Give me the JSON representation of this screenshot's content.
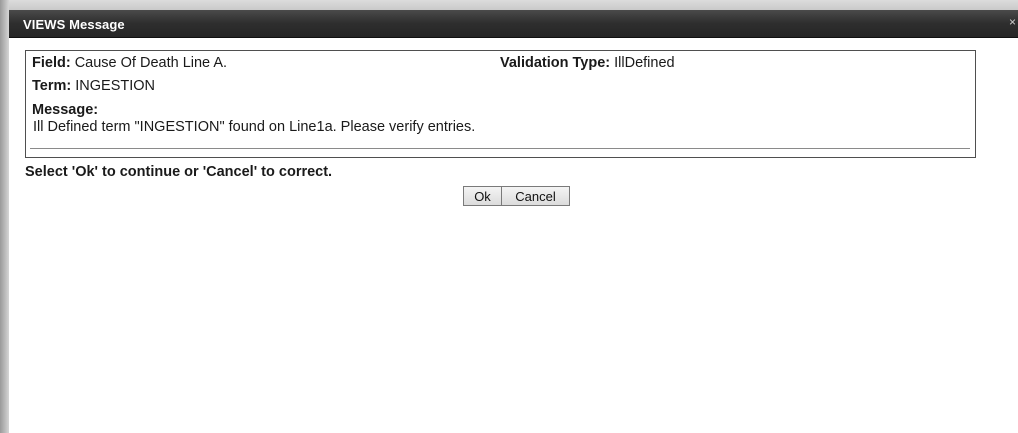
{
  "dialog": {
    "title": "VIEWS Message",
    "close_glyph": "×"
  },
  "details": {
    "field_label": "Field:",
    "field_value": "Cause Of Death Line A.",
    "validation_label": "Validation Type:",
    "validation_value": "IllDefined",
    "term_label": "Term:",
    "term_value": "INGESTION",
    "message_label": "Message:",
    "message_text": "Ill Defined term \"INGESTION\" found on Line1a. Please verify entries."
  },
  "prompt": "Select 'Ok' to continue or 'Cancel' to correct.",
  "buttons": {
    "ok_label": "Ok",
    "cancel_label": "Cancel"
  },
  "colors": {
    "titlebar": "#2e2e2e",
    "title_text": "#ffffff",
    "border": "#4f4f4f"
  }
}
